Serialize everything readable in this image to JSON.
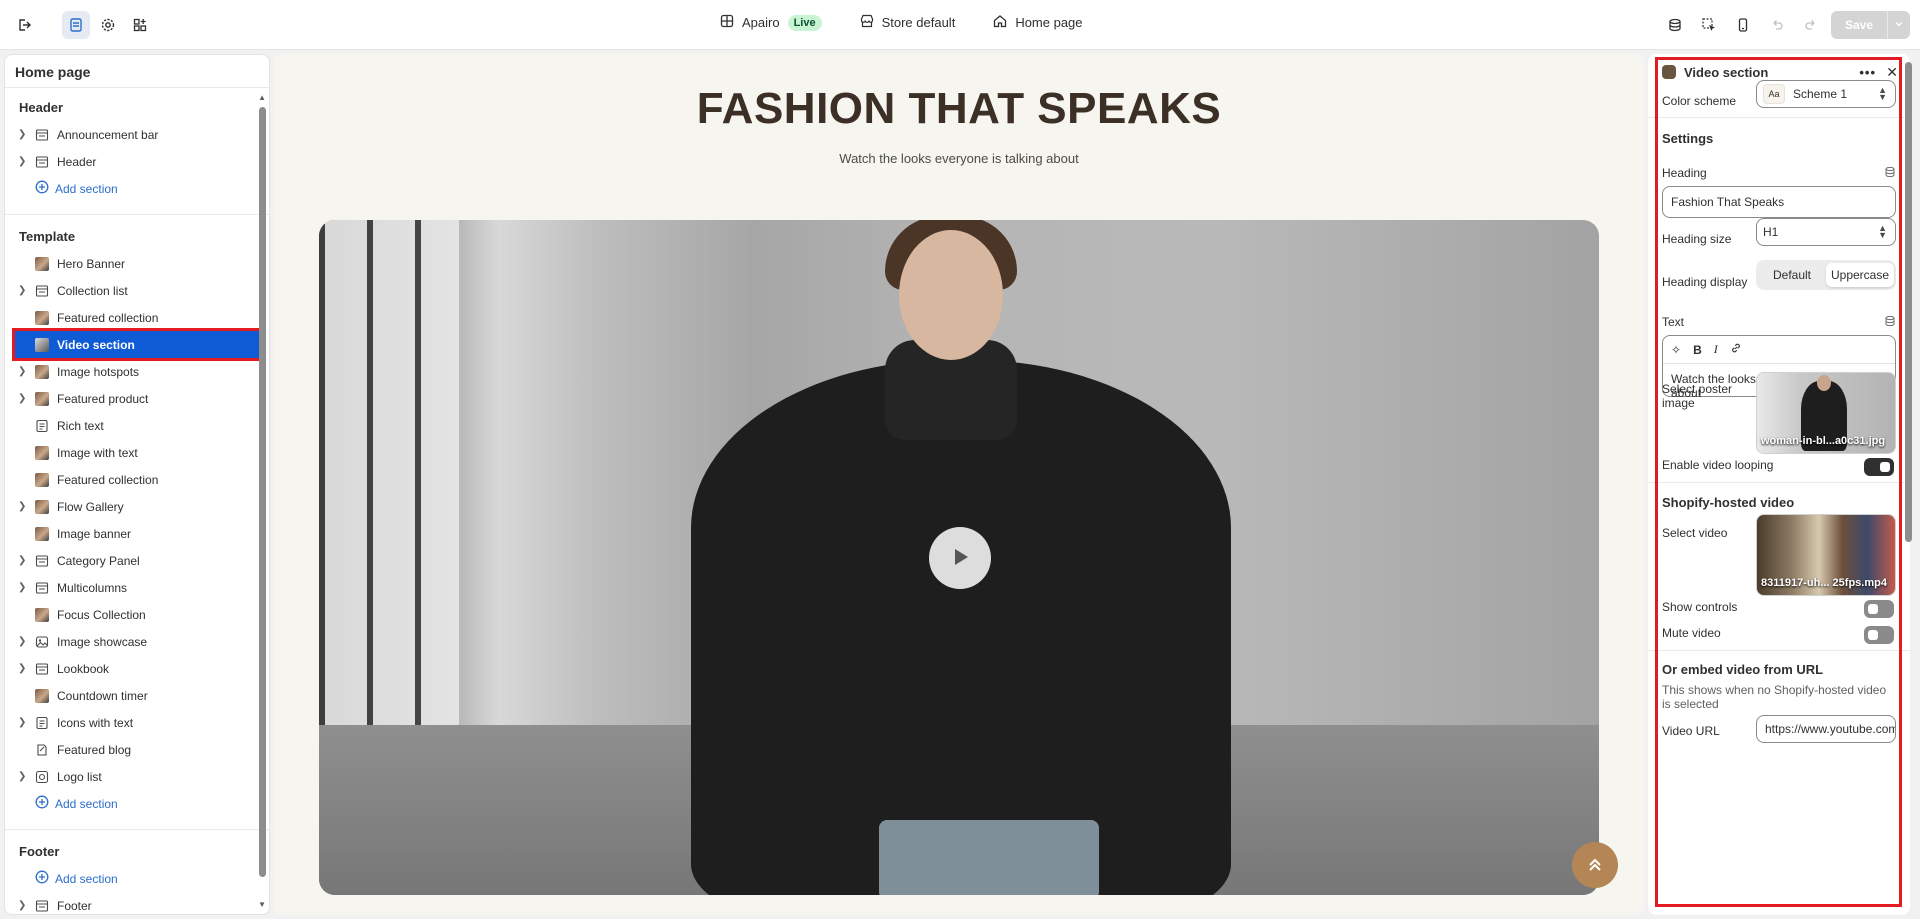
{
  "topbar": {
    "store_name": "Apairo",
    "live_badge": "Live",
    "theme_label": "Store default",
    "page_label": "Home page",
    "save_label": "Save"
  },
  "left": {
    "title": "Home page",
    "header_group": "Header",
    "header_items": [
      {
        "label": "Announcement bar",
        "icon": "layout-icon",
        "expandable": true
      },
      {
        "label": "Header",
        "icon": "layout-icon",
        "expandable": true
      }
    ],
    "add_section": "Add section",
    "template_group": "Template",
    "template_items": [
      {
        "label": "Hero Banner",
        "icon": "image-thumb",
        "expandable": false
      },
      {
        "label": "Collection list",
        "icon": "layout-icon",
        "expandable": true
      },
      {
        "label": "Featured collection",
        "icon": "image-thumb",
        "expandable": false
      },
      {
        "label": "Video section",
        "icon": "image-thumb",
        "expandable": false,
        "selected": true
      },
      {
        "label": "Image hotspots",
        "icon": "image-thumb",
        "expandable": true
      },
      {
        "label": "Featured product",
        "icon": "image-thumb",
        "expandable": true
      },
      {
        "label": "Rich text",
        "icon": "text-icon",
        "expandable": false
      },
      {
        "label": "Image with text",
        "icon": "image-thumb",
        "expandable": false
      },
      {
        "label": "Featured collection",
        "icon": "image-thumb",
        "expandable": false
      },
      {
        "label": "Flow Gallery",
        "icon": "image-thumb",
        "expandable": true
      },
      {
        "label": "Image banner",
        "icon": "image-thumb",
        "expandable": false
      },
      {
        "label": "Category Panel",
        "icon": "layout-icon",
        "expandable": true
      },
      {
        "label": "Multicolumns",
        "icon": "layout-icon",
        "expandable": true
      },
      {
        "label": "Focus Collection",
        "icon": "image-thumb",
        "expandable": false
      },
      {
        "label": "Image showcase",
        "icon": "image-icon",
        "expandable": true
      },
      {
        "label": "Lookbook",
        "icon": "layout-icon",
        "expandable": true
      },
      {
        "label": "Countdown timer",
        "icon": "image-thumb",
        "expandable": false
      },
      {
        "label": "Icons with text",
        "icon": "text-icon",
        "expandable": true
      },
      {
        "label": "Featured blog",
        "icon": "blog-icon",
        "expandable": false
      },
      {
        "label": "Logo list",
        "icon": "logo-icon",
        "expandable": true
      }
    ],
    "footer_group": "Footer",
    "footer_items": [
      {
        "label": "Footer",
        "icon": "layout-icon",
        "expandable": true
      }
    ]
  },
  "preview": {
    "heading": "FASHION THAT SPEAKS",
    "subheading": "Watch the looks everyone is talking about"
  },
  "panel": {
    "title": "Video section",
    "color_scheme_label": "Color scheme",
    "color_scheme_value": "Scheme 1",
    "color_scheme_swatch": "Aa",
    "settings_heading": "Settings",
    "heading_label": "Heading",
    "heading_value": "Fashion That Speaks",
    "heading_size_label": "Heading size",
    "heading_size_value": "H1",
    "heading_display_label": "Heading display",
    "heading_display_options": [
      "Default",
      "Uppercase"
    ],
    "heading_display_selected": "Uppercase",
    "text_label": "Text",
    "text_value": "Watch the looks everyone is talking about",
    "poster_label": "Select poster image",
    "poster_file": "woman-in-bl...a0c31.jpg",
    "looping_label": "Enable video looping",
    "looping_on": true,
    "hosted_heading": "Shopify-hosted video",
    "select_video_label": "Select video",
    "video_file": "8311917-uh... 25fps.mp4",
    "show_controls_label": "Show controls",
    "show_controls_on": false,
    "mute_label": "Mute video",
    "mute_on": false,
    "embed_heading": "Or embed video from URL",
    "embed_note": "This shows when no Shopify-hosted video is selected",
    "video_url_label": "Video URL",
    "video_url_value": "https://www.youtube.com"
  },
  "colors": {
    "selected": "#0f5bd6",
    "highlight": "#e31b23",
    "link": "#2c6ecb",
    "live_bg": "#c9f4d4",
    "heading_color": "#3b2f26",
    "scroll_button": "#b48656"
  }
}
